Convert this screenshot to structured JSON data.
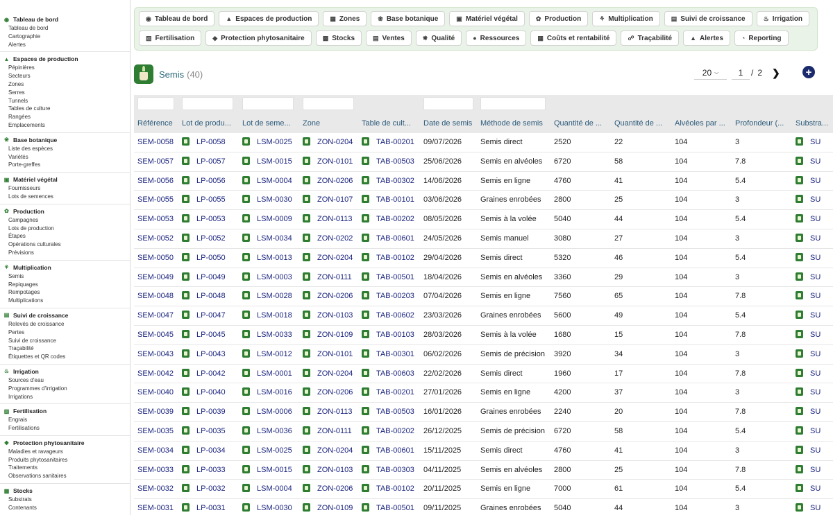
{
  "sidebar": {
    "groups": [
      {
        "icon": "dashboard-icon",
        "title": "Tableau de bord",
        "items": [
          "Tableau de bord",
          "Cartographie",
          "Alertes"
        ]
      },
      {
        "icon": "greenhouse-icon",
        "title": "Espaces de production",
        "items": [
          "Pépinières",
          "Secteurs",
          "Zones",
          "Serres",
          "Tunnels",
          "Tables de culture",
          "Rangées",
          "Emplacements"
        ]
      },
      {
        "icon": "leaf-icon",
        "title": "Base botanique",
        "items": [
          "Liste des espèces",
          "Variétés",
          "Porte-greffes"
        ]
      },
      {
        "icon": "box-icon",
        "title": "Matériel végétal",
        "items": [
          "Fournisseurs",
          "Lots de semences"
        ]
      },
      {
        "icon": "sprout-icon",
        "title": "Production",
        "items": [
          "Campagnes",
          "Lots de production",
          "Étapes",
          "Opérations culturales",
          "Prévisions"
        ]
      },
      {
        "icon": "plant-icon",
        "title": "Multiplication",
        "items": [
          "Semis",
          "Repiquages",
          "Rempotages",
          "Multiplications"
        ]
      },
      {
        "icon": "chart-icon",
        "title": "Suivi de croissance",
        "items": [
          "Relevés de croissance",
          "Pertes",
          "Suivi de croissance",
          "Traçabilité",
          "Étiquettes et QR codes"
        ]
      },
      {
        "icon": "water-icon",
        "title": "Irrigation",
        "items": [
          "Sources d'eau",
          "Programmes d'irrigation",
          "Irrigations"
        ]
      },
      {
        "icon": "flask-icon",
        "title": "Fertilisation",
        "items": [
          "Engrais",
          "Fertilisations"
        ]
      },
      {
        "icon": "shield-icon",
        "title": "Protection phytosanitaire",
        "items": [
          "Maladies et ravageurs",
          "Produits phytosanitaires",
          "Traitements",
          "Observations sanitaires"
        ]
      },
      {
        "icon": "stock-icon",
        "title": "Stocks",
        "items": [
          "Substrats",
          "Contenants"
        ]
      }
    ]
  },
  "topnav": {
    "row1": [
      {
        "icon": "dashboard-icon",
        "label": "Tableau de bord"
      },
      {
        "icon": "greenhouse-icon",
        "label": "Espaces de production"
      },
      {
        "icon": "map-icon",
        "label": "Zones"
      },
      {
        "icon": "leaf-icon",
        "label": "Base botanique"
      },
      {
        "icon": "box-icon",
        "label": "Matériel végétal"
      },
      {
        "icon": "sprout-icon",
        "label": "Production"
      },
      {
        "icon": "plant-icon",
        "label": "Multiplication"
      },
      {
        "icon": "chart-icon",
        "label": "Suivi de croissance"
      },
      {
        "icon": "water-icon",
        "label": "Irrigation"
      }
    ],
    "row2": [
      {
        "icon": "flask-icon",
        "label": "Fertilisation"
      },
      {
        "icon": "shield-icon",
        "label": "Protection phytosanitaire"
      },
      {
        "icon": "stock-icon",
        "label": "Stocks"
      },
      {
        "icon": "cart-icon",
        "label": "Ventes"
      },
      {
        "icon": "quality-icon",
        "label": "Qualité"
      },
      {
        "icon": "people-icon",
        "label": "Ressources"
      },
      {
        "icon": "money-icon",
        "label": "Coûts et rentabilité"
      },
      {
        "icon": "trace-icon",
        "label": "Traçabilité"
      },
      {
        "icon": "bell-icon",
        "label": "Alertes"
      },
      {
        "icon": "pie-icon",
        "label": "Reporting"
      }
    ]
  },
  "page": {
    "title": "Semis",
    "count": "(40)",
    "page_size": "20",
    "page_current": "1",
    "page_sep": "/",
    "page_total": "2"
  },
  "table": {
    "columns": [
      "Référence",
      "Lot de produ...",
      "Lot de seme...",
      "Zone",
      "Table de cult...",
      "Date de semis",
      "Méthode de semis",
      "Quantité de ...",
      "Quantité de ...",
      "Alvéoles par ...",
      "Profondeur (...",
      "Substra..."
    ],
    "rows": [
      [
        "SEM-0058",
        "LP-0058",
        "LSM-0025",
        "ZON-0204",
        "TAB-00201",
        "09/07/2026",
        "Semis direct",
        "2520",
        "22",
        "104",
        "3",
        "SU"
      ],
      [
        "SEM-0057",
        "LP-0057",
        "LSM-0015",
        "ZON-0101",
        "TAB-00503",
        "25/06/2026",
        "Semis en alvéoles",
        "6720",
        "58",
        "104",
        "7.8",
        "SU"
      ],
      [
        "SEM-0056",
        "LP-0056",
        "LSM-0004",
        "ZON-0206",
        "TAB-00302",
        "14/06/2026",
        "Semis en ligne",
        "4760",
        "41",
        "104",
        "5.4",
        "SU"
      ],
      [
        "SEM-0055",
        "LP-0055",
        "LSM-0030",
        "ZON-0107",
        "TAB-00101",
        "03/06/2026",
        "Graines enrobées",
        "2800",
        "25",
        "104",
        "3",
        "SU"
      ],
      [
        "SEM-0053",
        "LP-0053",
        "LSM-0009",
        "ZON-0113",
        "TAB-00202",
        "08/05/2026",
        "Semis à la volée",
        "5040",
        "44",
        "104",
        "5.4",
        "SU"
      ],
      [
        "SEM-0052",
        "LP-0052",
        "LSM-0034",
        "ZON-0202",
        "TAB-00601",
        "24/05/2026",
        "Semis manuel",
        "3080",
        "27",
        "104",
        "3",
        "SU"
      ],
      [
        "SEM-0050",
        "LP-0050",
        "LSM-0013",
        "ZON-0204",
        "TAB-00102",
        "29/04/2026",
        "Semis direct",
        "5320",
        "46",
        "104",
        "5.4",
        "SU"
      ],
      [
        "SEM-0049",
        "LP-0049",
        "LSM-0003",
        "ZON-0111",
        "TAB-00501",
        "18/04/2026",
        "Semis en alvéoles",
        "3360",
        "29",
        "104",
        "3",
        "SU"
      ],
      [
        "SEM-0048",
        "LP-0048",
        "LSM-0028",
        "ZON-0206",
        "TAB-00203",
        "07/04/2026",
        "Semis en ligne",
        "7560",
        "65",
        "104",
        "7.8",
        "SU"
      ],
      [
        "SEM-0047",
        "LP-0047",
        "LSM-0018",
        "ZON-0103",
        "TAB-00602",
        "23/03/2026",
        "Graines enrobées",
        "5600",
        "49",
        "104",
        "5.4",
        "SU"
      ],
      [
        "SEM-0045",
        "LP-0045",
        "LSM-0033",
        "ZON-0109",
        "TAB-00103",
        "28/03/2026",
        "Semis à la volée",
        "1680",
        "15",
        "104",
        "7.8",
        "SU"
      ],
      [
        "SEM-0043",
        "LP-0043",
        "LSM-0012",
        "ZON-0101",
        "TAB-00301",
        "06/02/2026",
        "Semis de précision",
        "3920",
        "34",
        "104",
        "3",
        "SU"
      ],
      [
        "SEM-0042",
        "LP-0042",
        "LSM-0001",
        "ZON-0204",
        "TAB-00603",
        "22/02/2026",
        "Semis direct",
        "1960",
        "17",
        "104",
        "7.8",
        "SU"
      ],
      [
        "SEM-0040",
        "LP-0040",
        "LSM-0016",
        "ZON-0206",
        "TAB-00201",
        "27/01/2026",
        "Semis en ligne",
        "4200",
        "37",
        "104",
        "3",
        "SU"
      ],
      [
        "SEM-0039",
        "LP-0039",
        "LSM-0006",
        "ZON-0113",
        "TAB-00503",
        "16/01/2026",
        "Graines enrobées",
        "2240",
        "20",
        "104",
        "7.8",
        "SU"
      ],
      [
        "SEM-0035",
        "LP-0035",
        "LSM-0036",
        "ZON-0111",
        "TAB-00202",
        "26/12/2025",
        "Semis de précision",
        "6720",
        "58",
        "104",
        "5.4",
        "SU"
      ],
      [
        "SEM-0034",
        "LP-0034",
        "LSM-0025",
        "ZON-0204",
        "TAB-00601",
        "15/11/2025",
        "Semis direct",
        "4760",
        "41",
        "104",
        "3",
        "SU"
      ],
      [
        "SEM-0033",
        "LP-0033",
        "LSM-0015",
        "ZON-0103",
        "TAB-00303",
        "04/11/2025",
        "Semis en alvéoles",
        "2800",
        "25",
        "104",
        "7.8",
        "SU"
      ],
      [
        "SEM-0032",
        "LP-0032",
        "LSM-0004",
        "ZON-0206",
        "TAB-00102",
        "20/11/2025",
        "Semis en ligne",
        "7000",
        "61",
        "104",
        "5.4",
        "SU"
      ],
      [
        "SEM-0031",
        "LP-0031",
        "LSM-0030",
        "ZON-0109",
        "TAB-00501",
        "09/11/2025",
        "Graines enrobées",
        "5040",
        "44",
        "104",
        "3",
        "SU"
      ]
    ]
  }
}
